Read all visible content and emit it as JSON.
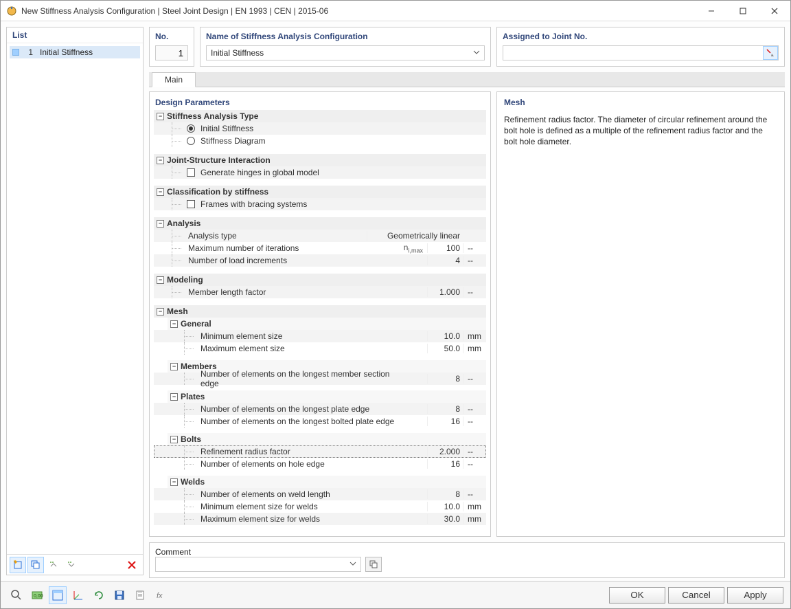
{
  "window": {
    "title": "New Stiffness Analysis Configuration | Steel Joint Design | EN 1993 | CEN | 2015-06"
  },
  "sidebar": {
    "header": "List",
    "items": [
      {
        "index": "1",
        "label": "Initial Stiffness"
      }
    ]
  },
  "fields": {
    "no_label": "No.",
    "no_value": "1",
    "name_label": "Name of Stiffness Analysis Configuration",
    "name_value": "Initial Stiffness",
    "assigned_label": "Assigned to Joint No.",
    "assigned_value": ""
  },
  "tabs": {
    "main": "Main"
  },
  "sections": {
    "design_parameters": "Design Parameters",
    "stiffness_type": {
      "title": "Stiffness Analysis Type",
      "opt_initial": "Initial Stiffness",
      "opt_diagram": "Stiffness Diagram"
    },
    "jsi": {
      "title": "Joint-Structure Interaction",
      "opt_hinges": "Generate hinges in global model"
    },
    "classification": {
      "title": "Classification by stiffness",
      "opt_bracing": "Frames with bracing systems"
    },
    "analysis": {
      "title": "Analysis",
      "rows": {
        "type_lbl": "Analysis type",
        "type_val": "Geometrically linear",
        "iter_lbl": "Maximum number of iterations",
        "iter_sym": "n",
        "iter_sub": "i,max",
        "iter_val": "100",
        "incr_lbl": "Number of load increments",
        "incr_val": "4"
      }
    },
    "modeling": {
      "title": "Modeling",
      "len_lbl": "Member length factor",
      "len_val": "1.000"
    },
    "mesh": {
      "title": "Mesh",
      "general": {
        "title": "General",
        "min_lbl": "Minimum element size",
        "min_val": "10.0",
        "mm": "mm",
        "max_lbl": "Maximum element size",
        "max_val": "50.0"
      },
      "members": {
        "title": "Members",
        "lbl": "Number of elements on the longest member section edge",
        "val": "8"
      },
      "plates": {
        "title": "Plates",
        "l1": "Number of elements on the longest plate edge",
        "v1": "8",
        "l2": "Number of elements on the longest bolted plate edge",
        "v2": "16"
      },
      "bolts": {
        "title": "Bolts",
        "l1": "Refinement radius factor",
        "v1": "2.000",
        "l2": "Number of elements on hole edge",
        "v2": "16"
      },
      "welds": {
        "title": "Welds",
        "l1": "Number of elements on weld length",
        "v1": "8",
        "l2": "Minimum element size for welds",
        "v2": "10.0",
        "l3": "Maximum element size for welds",
        "v3": "30.0"
      }
    }
  },
  "desc": {
    "title": "Mesh",
    "text": "Refinement radius factor. The diameter of circular refinement around the bolt hole is defined as a multiple of the refinement radius factor and the bolt hole diameter."
  },
  "comment": {
    "label": "Comment",
    "value": ""
  },
  "units": {
    "mm": "mm",
    "dash": "--"
  },
  "footer": {
    "ok": "OK",
    "cancel": "Cancel",
    "apply": "Apply"
  }
}
